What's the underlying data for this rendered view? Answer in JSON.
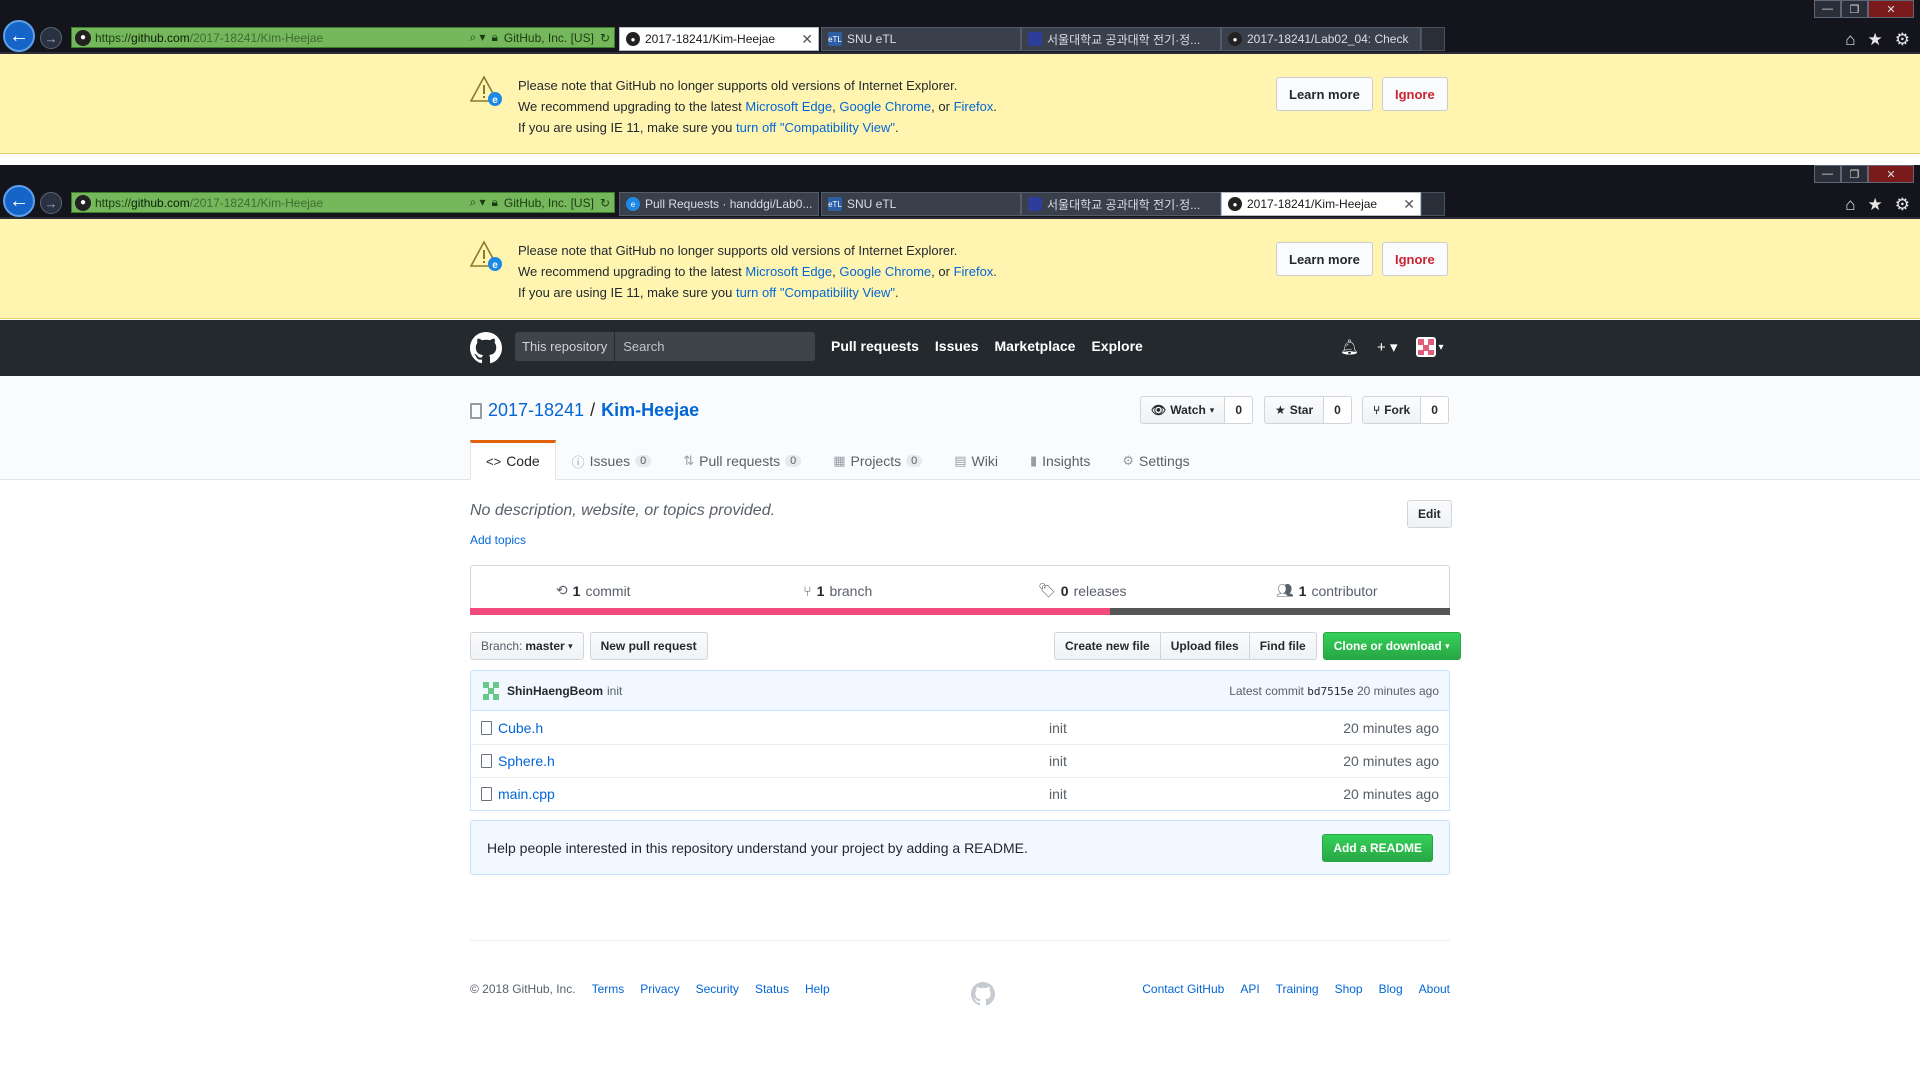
{
  "browser": {
    "url_prefix": "https://",
    "url_host": "github.com",
    "url_path": "/2017-18241/Kim-Heejae",
    "search_glyph": "⌕ ▾",
    "security_label": "GitHub, Inc. [US]",
    "refresh_glyph": "↻",
    "tabs_top": [
      {
        "label": "2017-18241/Kim-Heejae",
        "active": true
      },
      {
        "label": "SNU eTL",
        "active": false
      },
      {
        "label": "서울대학교 공과대학 전기·정...",
        "active": false
      },
      {
        "label": "2017-18241/Lab02_04: Check",
        "active": false
      }
    ],
    "tabs_bottom": [
      {
        "label": "Pull Requests · handdgi/Lab0...",
        "active": false
      },
      {
        "label": "SNU eTL",
        "active": false
      },
      {
        "label": "서울대학교 공과대학 전기·정...",
        "active": false
      },
      {
        "label": "2017-18241/Kim-Heejae",
        "active": true
      }
    ],
    "tab_icon_etl": "eTL"
  },
  "banner": {
    "line1": "Please note that GitHub no longer supports old versions of Internet Explorer.",
    "line2_pre": "We recommend upgrading to the latest",
    "edge": "Microsoft Edge",
    "sep1": ",",
    "chrome": "Google Chrome",
    "sep2": ", or",
    "firefox": "Firefox",
    "end2": ".",
    "line3_pre": "If you are using IE 11, make sure you",
    "compat": "turn off \"Compatibility View\"",
    "end3": ".",
    "learn_more": "Learn more",
    "ignore": "Ignore"
  },
  "header": {
    "search_scope": "This repository",
    "search_placeholder": "Search",
    "nav": [
      "Pull requests",
      "Issues",
      "Marketplace",
      "Explore"
    ]
  },
  "repo": {
    "owner": "2017-18241",
    "separator": "/",
    "name": "Kim-Heejae",
    "watch": {
      "label": "Watch",
      "count": "0"
    },
    "star": {
      "label": "Star",
      "count": "0"
    },
    "fork": {
      "label": "Fork",
      "count": "0"
    },
    "tabs": [
      {
        "label": "Code",
        "icon": "<>",
        "count": null
      },
      {
        "label": "Issues",
        "icon": "ⓘ",
        "count": "0"
      },
      {
        "label": "Pull requests",
        "icon": "⇅",
        "count": "0"
      },
      {
        "label": "Projects",
        "icon": "▦",
        "count": "0"
      },
      {
        "label": "Wiki",
        "icon": "▤",
        "count": null
      },
      {
        "label": "Insights",
        "icon": "▮",
        "count": null
      },
      {
        "label": "Settings",
        "icon": "⚙",
        "count": null
      }
    ]
  },
  "summary": {
    "description": "No description, website, or topics provided.",
    "add_topics": "Add topics",
    "edit": "Edit",
    "commits": {
      "num": "1",
      "label": "commit"
    },
    "branches": {
      "num": "1",
      "label": "branch"
    },
    "releases": {
      "num": "0",
      "label": "releases"
    },
    "contributors": {
      "num": "1",
      "label": "contributor"
    },
    "languages": [
      {
        "share": 0.653,
        "color": "#f34b7d"
      },
      {
        "share": 0.347,
        "color": "#555555"
      }
    ]
  },
  "file_nav": {
    "branch_label": "Branch:",
    "branch": "master",
    "new_pr": "New pull request",
    "create": "Create new file",
    "upload": "Upload files",
    "find": "Find file",
    "clone": "Clone or download"
  },
  "commit": {
    "author": "ShinHaengBeom",
    "message": "init",
    "latest_label": "Latest commit",
    "sha": "bd7515e",
    "age": "20 minutes ago"
  },
  "files": [
    {
      "name": "Cube.h",
      "message": "init",
      "age": "20 minutes ago"
    },
    {
      "name": "Sphere.h",
      "message": "init",
      "age": "20 minutes ago"
    },
    {
      "name": "main.cpp",
      "message": "init",
      "age": "20 minutes ago"
    }
  ],
  "readme": {
    "text": "Help people interested in this repository understand your project by adding a README.",
    "button": "Add a README"
  },
  "footer": {
    "copyright": "© 2018 GitHub, Inc.",
    "left_links": [
      "Terms",
      "Privacy",
      "Security",
      "Status",
      "Help"
    ],
    "right_links": [
      "Contact GitHub",
      "API",
      "Training",
      "Shop",
      "Blog",
      "About"
    ]
  }
}
